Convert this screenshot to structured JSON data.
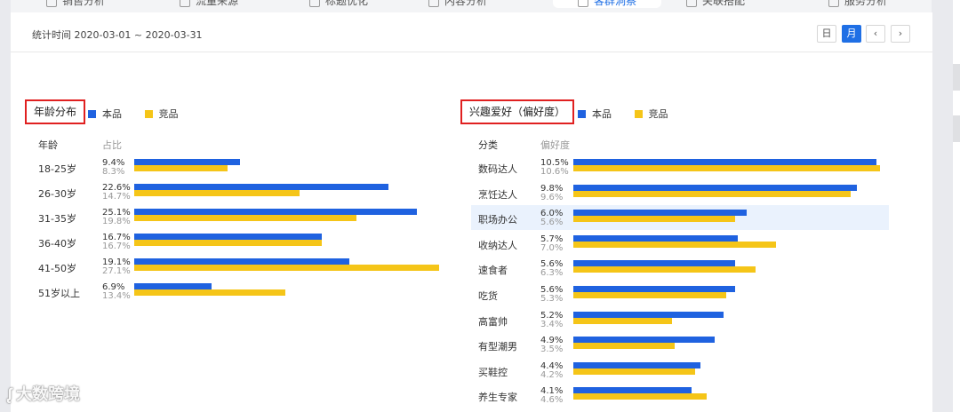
{
  "tabs": [
    {
      "label": "销售分析",
      "active": false
    },
    {
      "label": "流量来源",
      "active": false
    },
    {
      "label": "标题优化",
      "active": false
    },
    {
      "label": "内容分析",
      "active": false
    },
    {
      "label": "客群洞察",
      "active": true
    },
    {
      "label": "关联搭配",
      "active": false
    },
    {
      "label": "服务分析",
      "active": false
    }
  ],
  "header": {
    "period": "统计时间 2020-03-01 ~ 2020-03-31",
    "btn_day": "日",
    "btn_month": "月",
    "btn_prev": "‹",
    "btn_next": "›"
  },
  "colors": {
    "own": "#1f62e0",
    "competitor": "#f5c518",
    "accent": "#1f6fe5",
    "highlight_box": "#e02020"
  },
  "age": {
    "title": "年龄分布",
    "legend_own": "本品",
    "legend_comp": "竞品",
    "col_label": "年龄",
    "col_value": "占比",
    "rows": [
      {
        "label": "18-25岁",
        "own": 9.4,
        "comp": 8.3,
        "own_text": "9.4%",
        "comp_text": "8.3%"
      },
      {
        "label": "26-30岁",
        "own": 22.6,
        "comp": 14.7,
        "own_text": "22.6%",
        "comp_text": "14.7%"
      },
      {
        "label": "31-35岁",
        "own": 25.1,
        "comp": 19.8,
        "own_text": "25.1%",
        "comp_text": "19.8%"
      },
      {
        "label": "36-40岁",
        "own": 16.7,
        "comp": 16.7,
        "own_text": "16.7%",
        "comp_text": "16.7%"
      },
      {
        "label": "41-50岁",
        "own": 19.1,
        "comp": 27.1,
        "own_text": "19.1%",
        "comp_text": "27.1%"
      },
      {
        "label": "51岁以上",
        "own": 6.9,
        "comp": 13.4,
        "own_text": "6.9%",
        "comp_text": "13.4%"
      }
    ]
  },
  "interest": {
    "title": "兴趣爱好（偏好度）",
    "legend_own": "本品",
    "legend_comp": "竞品",
    "col_label": "分类",
    "col_value": "偏好度",
    "rows": [
      {
        "label": "数码达人",
        "own": 10.5,
        "comp": 10.6,
        "own_text": "10.5%",
        "comp_text": "10.6%"
      },
      {
        "label": "烹饪达人",
        "own": 9.8,
        "comp": 9.6,
        "own_text": "9.8%",
        "comp_text": "9.6%"
      },
      {
        "label": "职场办公",
        "own": 6.0,
        "comp": 5.6,
        "own_text": "6.0%",
        "comp_text": "5.6%",
        "highlighted": true
      },
      {
        "label": "收纳达人",
        "own": 5.7,
        "comp": 7.0,
        "own_text": "5.7%",
        "comp_text": "7.0%"
      },
      {
        "label": "速食者",
        "own": 5.6,
        "comp": 6.3,
        "own_text": "5.6%",
        "comp_text": "6.3%"
      },
      {
        "label": "吃货",
        "own": 5.6,
        "comp": 5.3,
        "own_text": "5.6%",
        "comp_text": "5.3%"
      },
      {
        "label": "高富帅",
        "own": 5.2,
        "comp": 3.4,
        "own_text": "5.2%",
        "comp_text": "3.4%"
      },
      {
        "label": "有型潮男",
        "own": 4.9,
        "comp": 3.5,
        "own_text": "4.9%",
        "comp_text": "3.5%"
      },
      {
        "label": "买鞋控",
        "own": 4.4,
        "comp": 4.2,
        "own_text": "4.4%",
        "comp_text": "4.2%"
      },
      {
        "label": "养生专家",
        "own": 4.1,
        "comp": 4.6,
        "own_text": "4.1%",
        "comp_text": "4.6%"
      }
    ]
  },
  "watermark": "大数跨境"
}
